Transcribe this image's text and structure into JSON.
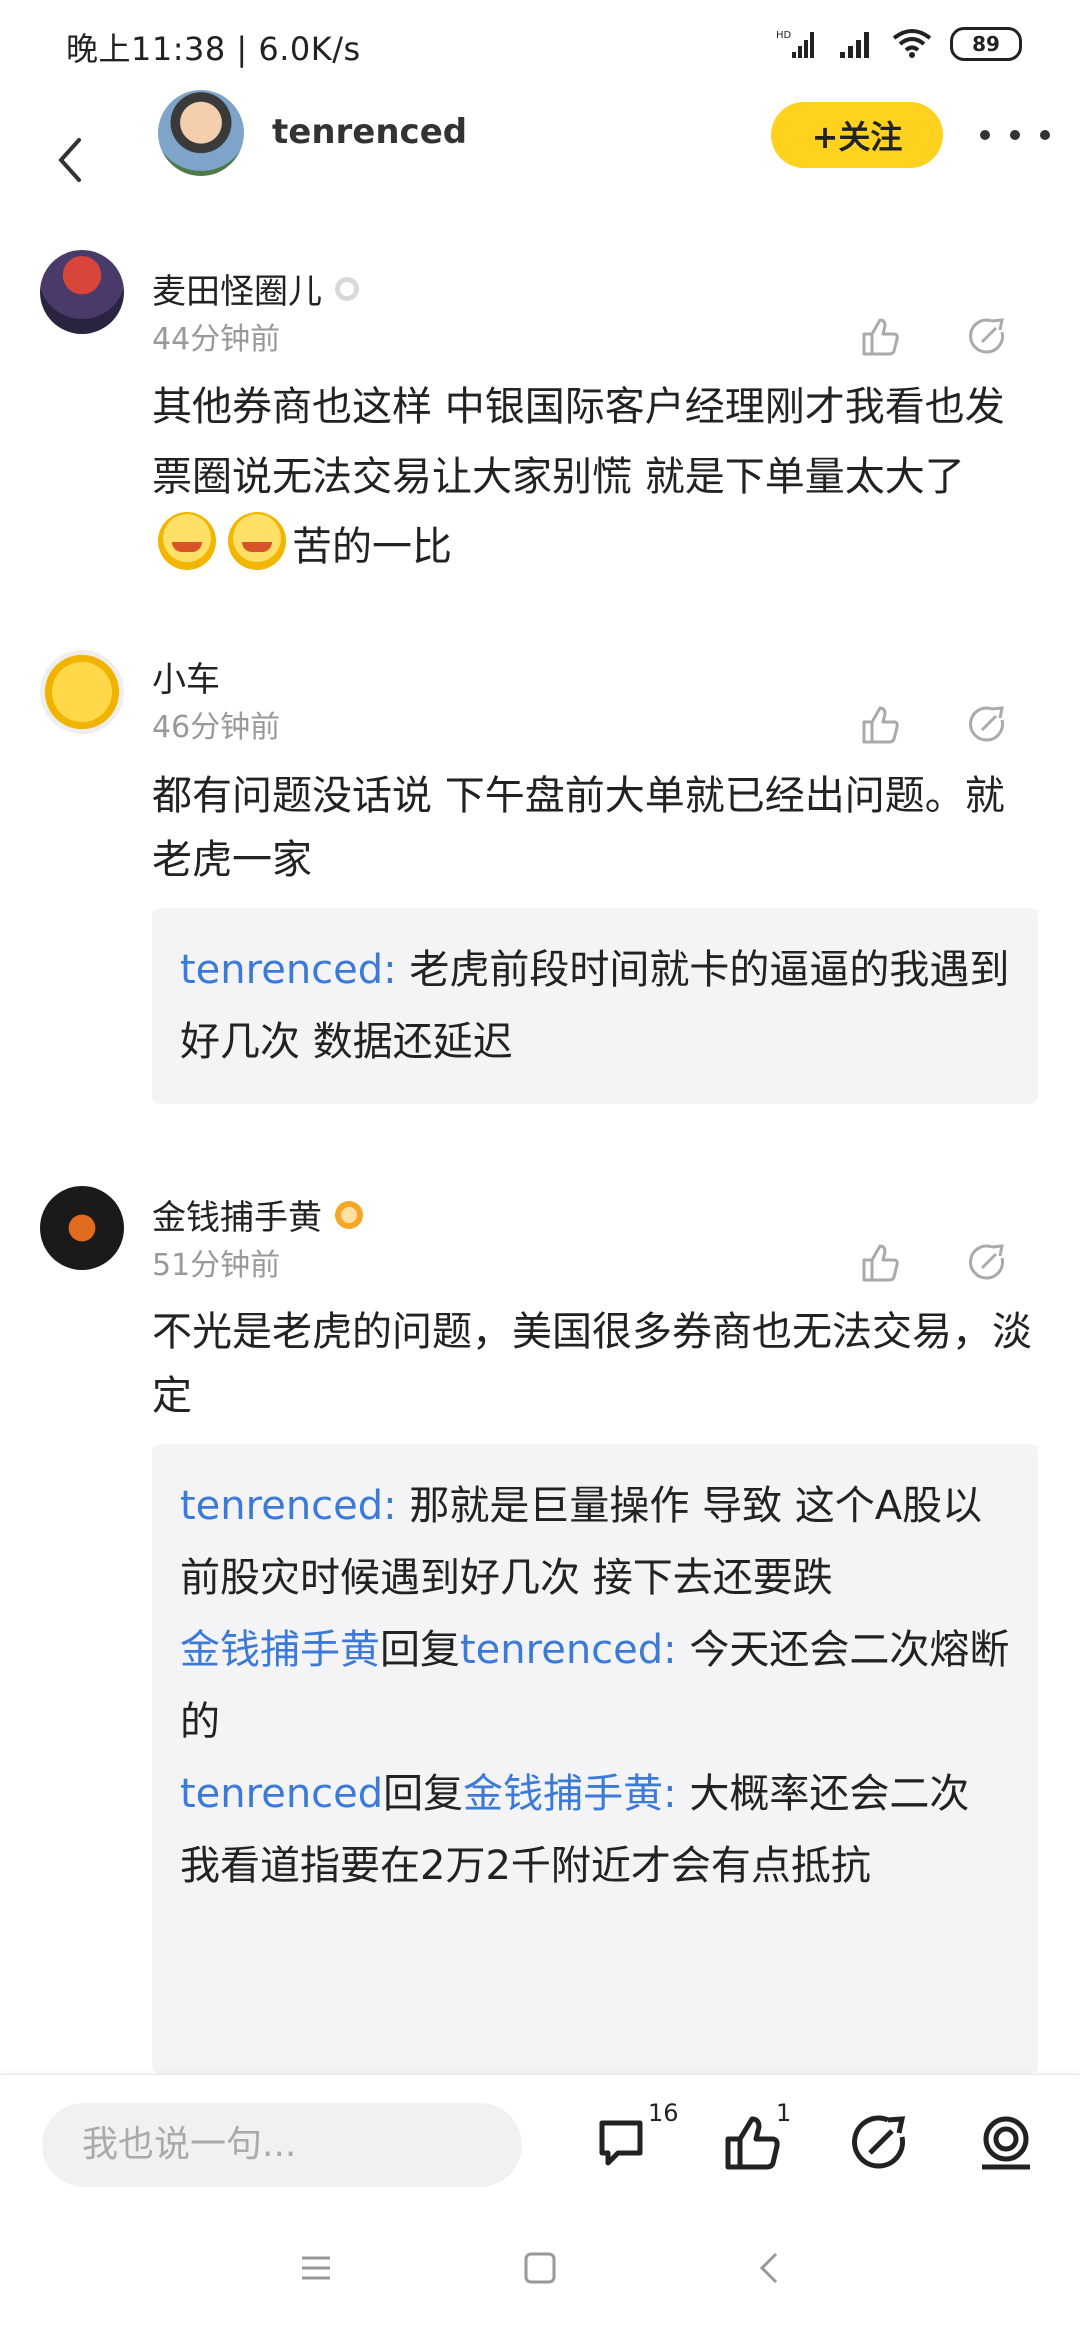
{
  "status": {
    "time": "晚上11:38 | 6.0K/s",
    "battery": "89"
  },
  "header": {
    "username": "tenrenced",
    "follow_label": "+关注"
  },
  "comments": [
    {
      "name": "麦田怪圈儿",
      "time": "44分钟前",
      "text_a": "其他券商也这样 中银国际客户经理刚才我看也发票圈说无法交易让大家别慌 就是下单量太大了",
      "text_b": "苦的一比"
    },
    {
      "name": "小车",
      "time": "46分钟前",
      "text": "都有问题没话说 下午盘前大单就已经出问题。就老虎一家",
      "replies": [
        {
          "from": "tenrenced",
          "sep": ": ",
          "text": "老虎前段时间就卡的逼逼的我遇到好几次  数据还延迟"
        }
      ]
    },
    {
      "name": "金钱捕手黄",
      "time": "51分钟前",
      "text": "不光是老虎的问题，美国很多券商也无法交易，淡定",
      "replies": [
        {
          "from": "tenrenced",
          "sep": ": ",
          "text": "那就是巨量操作 导致   这个A股以前股灾时候遇到好几次  接下去还要跌"
        },
        {
          "from": "金钱捕手黄",
          "mid": "回复",
          "to": "tenrenced",
          "sep": ": ",
          "text": "今天还会二次熔断的"
        },
        {
          "from": "tenrenced",
          "mid": "回复",
          "to": "金钱捕手黄",
          "sep": ": ",
          "text": "大概率还会二次  我看道指要在2万2千附近才会有点抵抗"
        }
      ]
    }
  ],
  "bottom": {
    "input_placeholder": "我也说一句...",
    "comment_count": "16",
    "like_count": "1"
  },
  "colors": {
    "accent_yellow": "#ffd21f",
    "link_blue": "#3b7ad8",
    "reply_bg": "#f4f4f6"
  }
}
